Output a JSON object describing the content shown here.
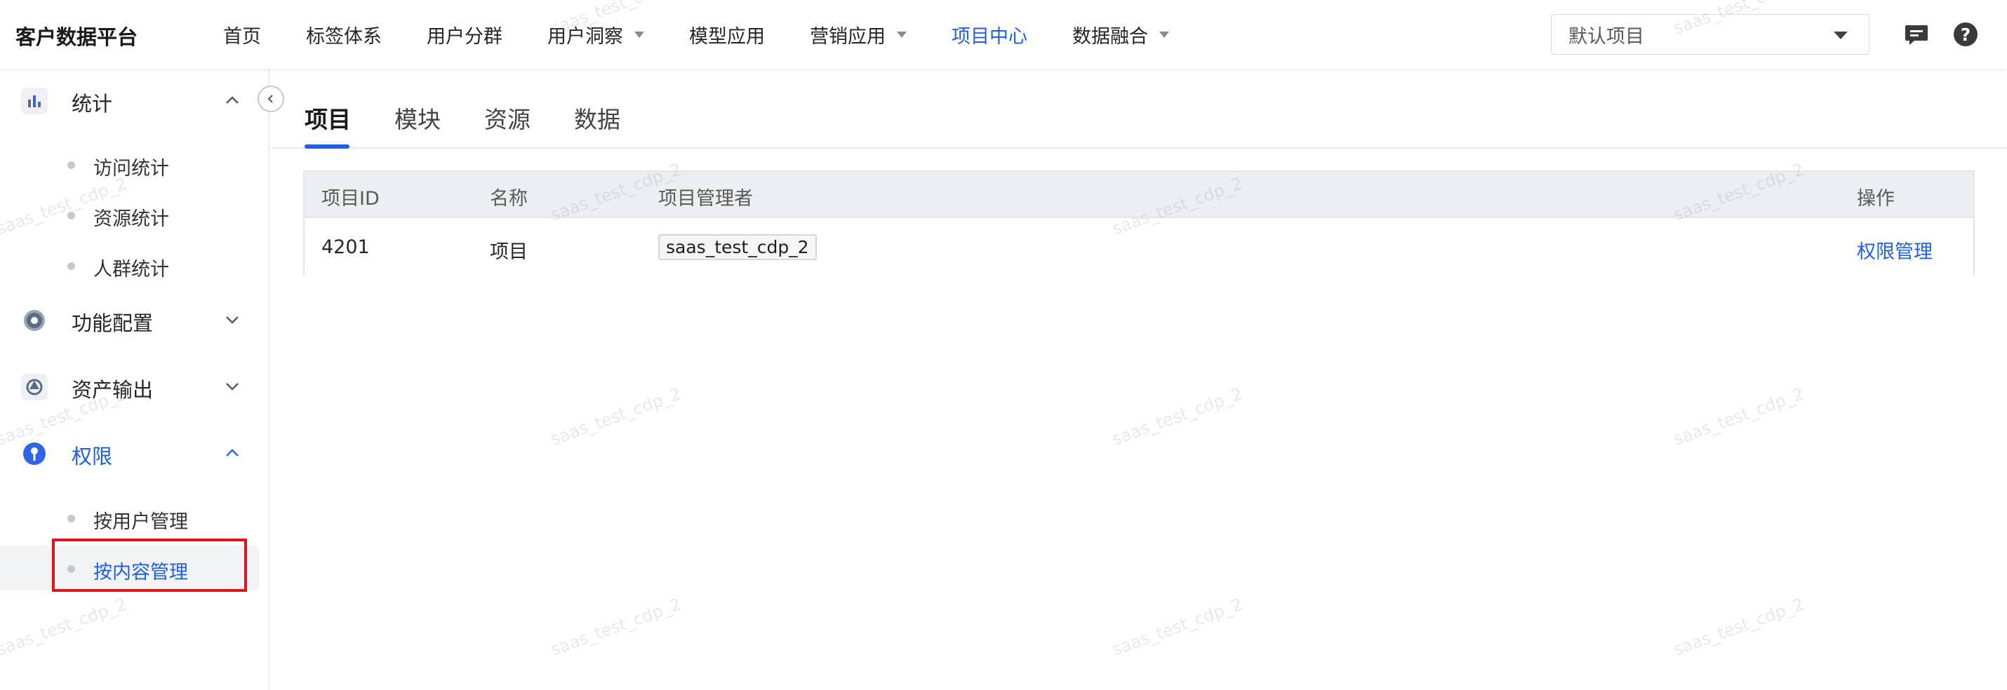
{
  "app": {
    "title": "客户数据平台"
  },
  "nav": {
    "items": [
      {
        "label": "首页",
        "dropdown": false,
        "active": false
      },
      {
        "label": "标签体系",
        "dropdown": false,
        "active": false
      },
      {
        "label": "用户分群",
        "dropdown": false,
        "active": false
      },
      {
        "label": "用户洞察",
        "dropdown": true,
        "active": false
      },
      {
        "label": "模型应用",
        "dropdown": false,
        "active": false
      },
      {
        "label": "营销应用",
        "dropdown": true,
        "active": false
      },
      {
        "label": "项目中心",
        "dropdown": false,
        "active": true
      },
      {
        "label": "数据融合",
        "dropdown": true,
        "active": false
      }
    ],
    "project_select": {
      "value": "默认项目"
    },
    "message_icon": "message-icon",
    "help_icon": "help-icon",
    "help_glyph": "?"
  },
  "sidebar": {
    "groups": [
      {
        "label": "统计",
        "icon": "bar-chart-icon",
        "expanded": true,
        "items": [
          "访问统计",
          "资源统计",
          "人群统计"
        ]
      },
      {
        "label": "功能配置",
        "icon": "gear-icon",
        "expanded": false,
        "items": []
      },
      {
        "label": "资产输出",
        "icon": "export-icon",
        "expanded": false,
        "items": []
      },
      {
        "label": "权限",
        "icon": "key-icon",
        "expanded": true,
        "items": [
          "按用户管理",
          "按内容管理"
        ]
      }
    ],
    "active_item": "按内容管理"
  },
  "tabs": {
    "items": [
      "项目",
      "模块",
      "资源",
      "数据"
    ],
    "active": "项目"
  },
  "table": {
    "columns": [
      "项目ID",
      "名称",
      "项目管理者",
      "操作"
    ],
    "rows": [
      {
        "id": "4201",
        "name": "项目",
        "manager": "saas_test_cdp_2",
        "action": "权限管理"
      }
    ]
  },
  "watermark": {
    "text": "saas_test_cdp_2"
  },
  "colors": {
    "accent": "#1f5fe0",
    "highlight": "#e0141e"
  }
}
